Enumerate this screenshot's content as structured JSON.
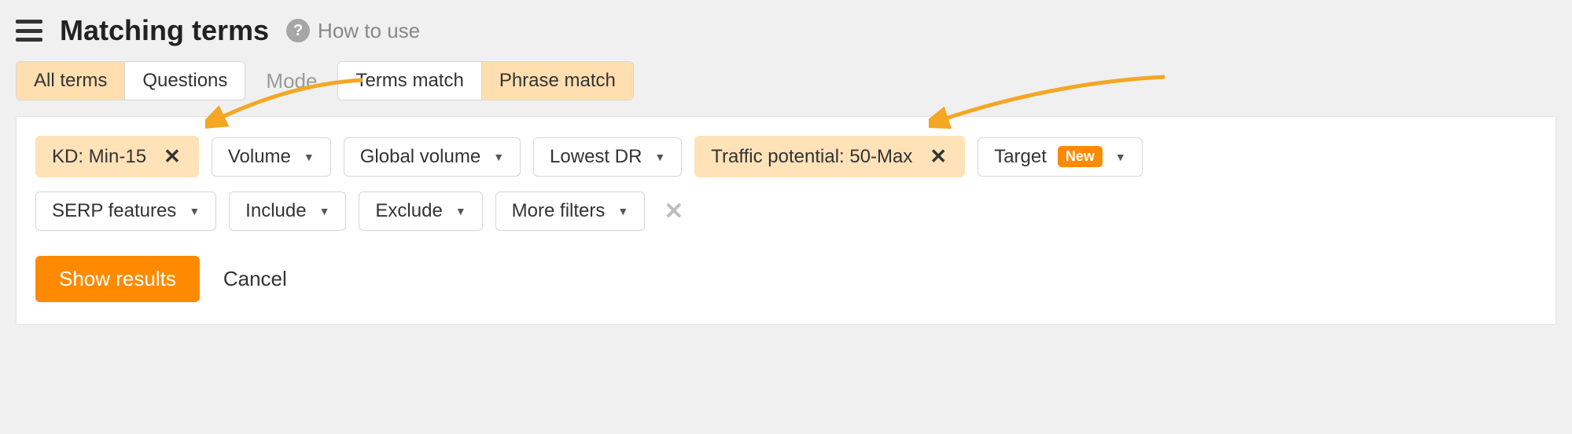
{
  "header": {
    "title": "Matching terms",
    "help_label": "How to use"
  },
  "toggles": {
    "type_group": {
      "options": [
        "All terms",
        "Questions"
      ],
      "active_index": 0
    },
    "mode_label": "Mode",
    "mode_group": {
      "options": [
        "Terms match",
        "Phrase match"
      ],
      "active_index": 1
    }
  },
  "filters": {
    "row1": [
      {
        "label": "KD: Min-15",
        "active": true,
        "removable": true,
        "dropdown": false
      },
      {
        "label": "Volume",
        "active": false,
        "dropdown": true
      },
      {
        "label": "Global volume",
        "active": false,
        "dropdown": true
      },
      {
        "label": "Lowest DR",
        "active": false,
        "dropdown": true
      },
      {
        "label": "Traffic potential: 50-Max",
        "active": true,
        "removable": true,
        "dropdown": false
      },
      {
        "label": "Target",
        "active": false,
        "dropdown": true,
        "badge": "New"
      }
    ],
    "row2": [
      {
        "label": "SERP features",
        "active": false,
        "dropdown": true
      },
      {
        "label": "Include",
        "active": false,
        "dropdown": true
      },
      {
        "label": "Exclude",
        "active": false,
        "dropdown": true
      },
      {
        "label": "More filters",
        "active": false,
        "dropdown": true
      }
    ]
  },
  "actions": {
    "primary": "Show results",
    "cancel": "Cancel"
  },
  "colors": {
    "accent": "#ff8a00",
    "active_chip_bg": "#ffe2b8",
    "active_seg_bg": "#ffdfaf"
  }
}
